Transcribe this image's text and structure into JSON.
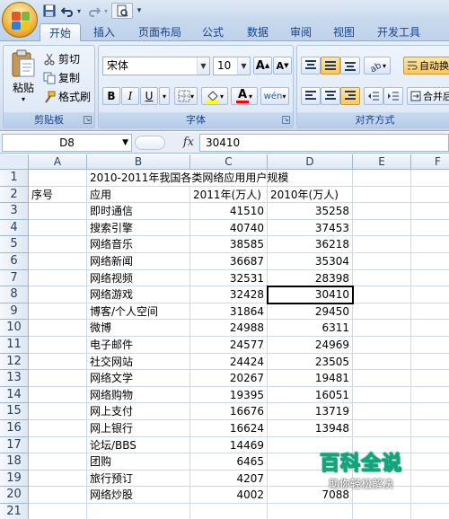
{
  "quick_access": {
    "save_icon": "save-icon",
    "undo_icon": "undo-icon",
    "redo_icon": "redo-icon",
    "preview_icon": "print-preview-icon",
    "customize_arrow": "▾"
  },
  "tabs": [
    {
      "label": "开始",
      "active": true
    },
    {
      "label": "插入",
      "active": false
    },
    {
      "label": "页面布局",
      "active": false
    },
    {
      "label": "公式",
      "active": false
    },
    {
      "label": "数据",
      "active": false
    },
    {
      "label": "审阅",
      "active": false
    },
    {
      "label": "视图",
      "active": false
    },
    {
      "label": "开发工具",
      "active": false
    }
  ],
  "ribbon": {
    "clipboard": {
      "label": "剪贴板",
      "paste": "粘贴",
      "cut": "剪切",
      "copy": "复制",
      "format_painter": "格式刷"
    },
    "font": {
      "label": "字体",
      "font_name": "宋体",
      "font_size": "10",
      "grow_font": "A",
      "shrink_font": "A",
      "bold": "B",
      "italic": "I",
      "underline": "U",
      "font_color_letter": "A",
      "phonetic": "wén"
    },
    "alignment": {
      "label": "对齐方式",
      "wrap_text": "自动换",
      "merge_center": "合并后"
    }
  },
  "formula_bar": {
    "name_box": "D8",
    "fx": "fx",
    "formula": "30410"
  },
  "sheet": {
    "columns": [
      "A",
      "B",
      "C",
      "D",
      "E",
      "F"
    ],
    "rows": [
      {
        "n": "1",
        "A": "",
        "B": "2010-2011年我国各类网络应用用户规模",
        "C": "",
        "D": ""
      },
      {
        "n": "2",
        "A": "序号",
        "B": "应用",
        "C": "2011年(万人)",
        "D": "2010年(万人)"
      },
      {
        "n": "3",
        "A": "",
        "B": "即时通信",
        "C": "41510",
        "D": "35258"
      },
      {
        "n": "4",
        "A": "",
        "B": "搜索引擎",
        "C": "40740",
        "D": "37453"
      },
      {
        "n": "5",
        "A": "",
        "B": "网络音乐",
        "C": "38585",
        "D": "36218"
      },
      {
        "n": "6",
        "A": "",
        "B": "网络新闻",
        "C": "36687",
        "D": "35304"
      },
      {
        "n": "7",
        "A": "",
        "B": "网络视频",
        "C": "32531",
        "D": "28398"
      },
      {
        "n": "8",
        "A": "",
        "B": "网络游戏",
        "C": "32428",
        "D": "30410"
      },
      {
        "n": "9",
        "A": "",
        "B": "博客/个人空间",
        "C": "31864",
        "D": "29450"
      },
      {
        "n": "10",
        "A": "",
        "B": "微博",
        "C": "24988",
        "D": "6311"
      },
      {
        "n": "11",
        "A": "",
        "B": "电子邮件",
        "C": "24577",
        "D": "24969"
      },
      {
        "n": "12",
        "A": "",
        "B": "社交网站",
        "C": "24424",
        "D": "23505"
      },
      {
        "n": "13",
        "A": "",
        "B": "网络文学",
        "C": "20267",
        "D": "19481"
      },
      {
        "n": "14",
        "A": "",
        "B": "网络购物",
        "C": "19395",
        "D": "16051"
      },
      {
        "n": "15",
        "A": "",
        "B": "网上支付",
        "C": "16676",
        "D": "13719"
      },
      {
        "n": "16",
        "A": "",
        "B": "网上银行",
        "C": "16624",
        "D": "13948"
      },
      {
        "n": "17",
        "A": "",
        "B": "论坛/BBS",
        "C": "14469",
        "D": ""
      },
      {
        "n": "18",
        "A": "",
        "B": "团购",
        "C": "6465",
        "D": ""
      },
      {
        "n": "19",
        "A": "",
        "B": "旅行预订",
        "C": "4207",
        "D": ""
      },
      {
        "n": "20",
        "A": "",
        "B": "网络炒股",
        "C": "4002",
        "D": "7088"
      },
      {
        "n": "21",
        "A": "",
        "B": "",
        "C": "",
        "D": ""
      }
    ],
    "selected_cell": "D8"
  },
  "watermark": {
    "title": "百科全说",
    "subtitle": "助你轻松解决"
  },
  "colors": {
    "ribbon_text": "#15428b",
    "grid_line": "#d0d7e5",
    "header_border": "#9eb6ce",
    "watermark_green": "#14a37a"
  }
}
